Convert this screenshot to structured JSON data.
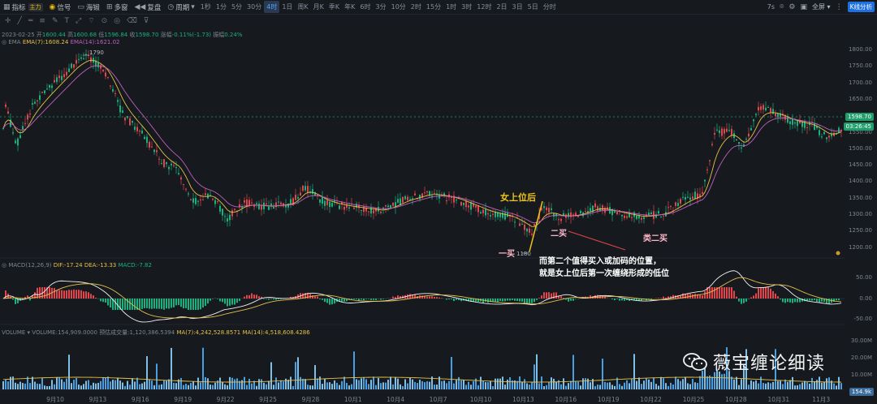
{
  "toolbar": {
    "indicators_label": "指标",
    "main_badge": "主力",
    "signal_label": "信号",
    "fund_label": "海锻",
    "multi_label": "多窗",
    "replay_label": "复盘",
    "period_label": "周期",
    "timeframes": [
      "1秒",
      "1分",
      "5分",
      "30分",
      "4时",
      "1日",
      "周K",
      "月K",
      "季K",
      "年K",
      "6时",
      "3分",
      "10分",
      "2时",
      "15分",
      "1时",
      "3时",
      "12时",
      "2日",
      "3日",
      "5日",
      "分时"
    ],
    "active_timeframe_index": 4,
    "right_seconds": "7s",
    "fullscreen_label": "全屏",
    "kline_button": "K线分析"
  },
  "ohlc_info": {
    "date": "2023-02-25",
    "open_label": "开",
    "open": "1600.44",
    "high_label": "高",
    "high": "1600.68",
    "low_label": "低",
    "low": "1596.84",
    "close_label": "收",
    "close": "1598.70",
    "change_label": "涨幅",
    "change": "-0.11%(-1.73)",
    "amp_label": "振幅",
    "amp": "0.24%"
  },
  "ema_info": {
    "name": "EMA",
    "ema7": "EMA(7):1608.24",
    "ema14": "EMA(14):1621.02"
  },
  "macd_info": {
    "name": "MACD(12,26,9)",
    "dif": "DIF:-17.24",
    "dea": "DEA:-13.33",
    "macd": "MACD:-7.82"
  },
  "volume_info": {
    "name": "VOLUME",
    "volume": "VOLUME:154,909.0000",
    "quote": "预估成交量:1,120,386.5394",
    "ma7": "MA(7):4,242,528.8571",
    "ma14": "MA(14):4,518,608.4286"
  },
  "price_axis": [
    "1800.00",
    "1750.00",
    "1700.00",
    "1650.00",
    "1600.00",
    "1550.00",
    "1500.00",
    "1450.00",
    "1400.00",
    "1350.00",
    "1300.00",
    "1250.00",
    "1200.00"
  ],
  "macd_axis": [
    "50.00",
    "0.00",
    "-50.00"
  ],
  "volume_axis": [
    "30.00M",
    "20.00M",
    "10.00M"
  ],
  "current_price": "1598.70",
  "countdown": "03:26:45",
  "current_volume": "154.9k",
  "high_marker": "1790",
  "low_marker": "1180",
  "x_axis_labels": [
    "9月10",
    "9月13",
    "9月16",
    "9月19",
    "9月22",
    "9月25",
    "9月28",
    "10月1",
    "10月4",
    "10月7",
    "10月10",
    "10月13",
    "10月16",
    "10月19",
    "10月22",
    "10月25",
    "10月28",
    "10月31",
    "11月3"
  ],
  "annotations": {
    "rise": "女上位后",
    "buy1": "一买",
    "buy2": "二买",
    "buy2_like": "类二买",
    "note_line1": "而第二个值得买入或加码的位置，",
    "note_line2": "就是女上位后第一次缠绕形成的低位"
  },
  "watermark": "薇宝缠论细读",
  "colors": {
    "up": "#e0464b",
    "down": "#19b27f",
    "ema7": "#e6c04a",
    "ema14": "#c060c0",
    "annotation_yellow": "#f0c419",
    "annotation_pink": "#ffb6c8",
    "annotation_white": "#ffffff",
    "volume_up": "#4a9fe0"
  }
}
